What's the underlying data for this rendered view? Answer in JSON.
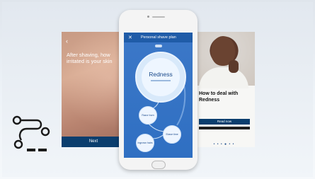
{
  "left_card": {
    "back_glyph": "‹",
    "question": "After shaving, how irritated is your skin",
    "scale_labels": [
      "None",
      "Medium",
      "Lots"
    ],
    "slider_level": 0.9,
    "next_label": "Next"
  },
  "phone": {
    "screen_title": "Personal shave plan",
    "close_glyph": "✕",
    "main_bubble": "Redness",
    "bubbles": [
      "Razor burn",
      "Ingrown hairs",
      "Shave time"
    ]
  },
  "right_card": {
    "title": "How to deal with Redness",
    "button_label": "Read now",
    "page_dots": "• • • ● • •"
  },
  "colors": {
    "navy": "#0b3e6e",
    "screen_blue": "#3c78c8",
    "bubble_text": "#1a4a8a"
  },
  "logo": {
    "icon": "path-flow-icon"
  }
}
